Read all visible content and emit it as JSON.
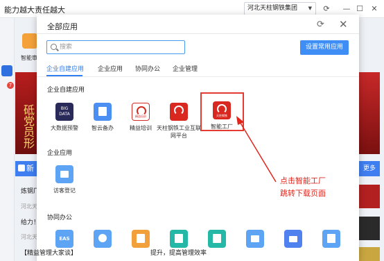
{
  "window": {
    "title": "能力越大责任越大",
    "org_selector": "河北天柱钢铁集团",
    "caret": "▼",
    "refresh_glyph": "⟳",
    "minimize_glyph": "—",
    "maximize_glyph": "☐",
    "close_glyph": "✕"
  },
  "background": {
    "left_badge": "7",
    "app_label": "智能审",
    "banner_text": "砥党员形",
    "news_tab": "新",
    "more": "更多",
    "lines": [
      "炼钢厂",
      "河北天",
      "给力！",
      "河北天"
    ],
    "bottom_left": "【精益管理大家谈】",
    "bottom_mid": "提升，提高管理效率"
  },
  "modal": {
    "title": "全部应用",
    "refresh_glyph": "⟳",
    "close_glyph": "✕",
    "search_placeholder": "搜索",
    "set_button": "设置常用应用",
    "tabs": [
      "企业自建应用",
      "企业应用",
      "协同办公",
      "企业管理"
    ],
    "sections": {
      "self_built": {
        "title": "企业自建应用",
        "apps": [
          {
            "label": "大数据预警",
            "icon": "big-data-icon",
            "tile_text": "BIG DATA"
          },
          {
            "label": "智云备办",
            "icon": "document-icon"
          },
          {
            "label": "精益培训",
            "icon": "training-logo-icon",
            "tile_text": "精益培训"
          },
          {
            "label": "天柱钢铁工业互联网平台",
            "icon": "platform-logo-icon"
          },
          {
            "label": "智能工厂",
            "icon": "factory-logo-icon",
            "tile_text": "天柱钢铁"
          }
        ]
      },
      "enterprise": {
        "title": "企业应用",
        "apps": [
          {
            "label": "访客登记",
            "icon": "visitor-form-icon"
          }
        ]
      },
      "collab": {
        "title": "协同办公",
        "apps": [
          {
            "icon": "eas-icon",
            "tile_text": "EAS"
          },
          {
            "icon": "location-icon"
          },
          {
            "icon": "document-edit-icon"
          },
          {
            "icon": "chart-card-icon"
          },
          {
            "icon": "approval-icon"
          },
          {
            "icon": "folder-icon"
          },
          {
            "icon": "mail-icon"
          },
          {
            "icon": "list-icon"
          }
        ]
      }
    }
  },
  "annotation": {
    "line1": "点击智能工厂",
    "line2": "跳转下载页面",
    "color": "#e1251b"
  }
}
